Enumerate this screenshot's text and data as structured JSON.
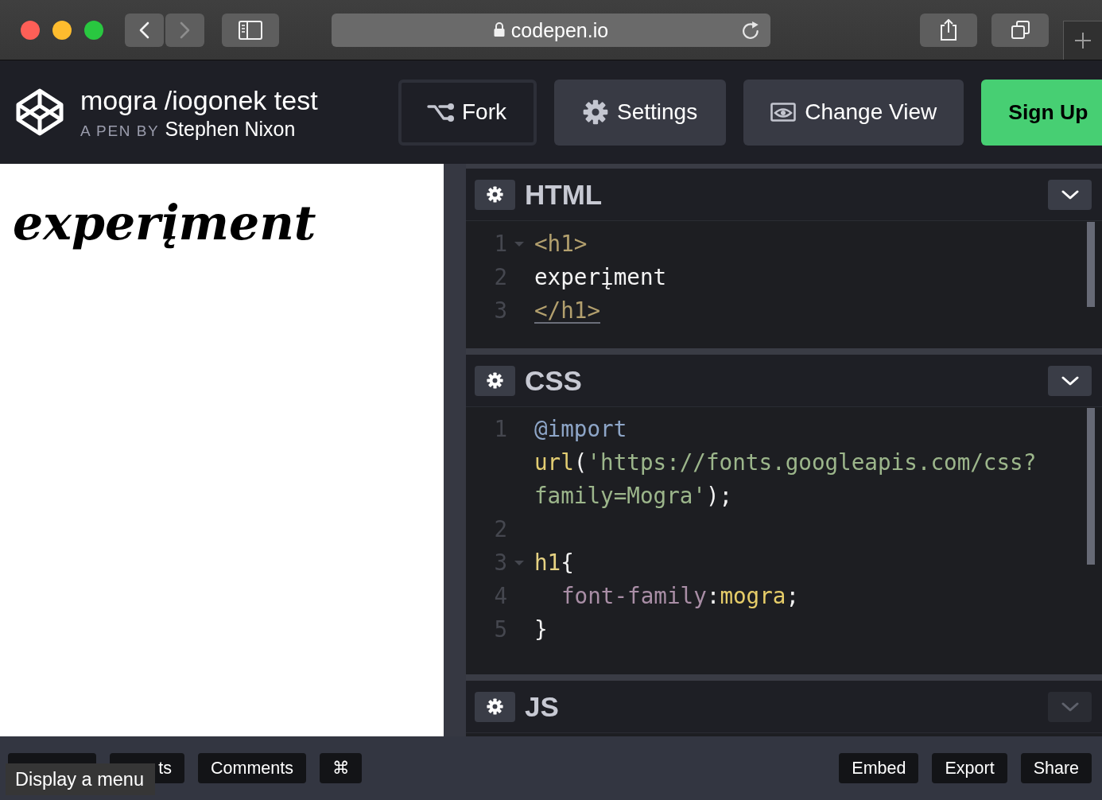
{
  "browser": {
    "back": {
      "disabled": false
    },
    "forward": {
      "disabled": true
    },
    "url": "codepen.io"
  },
  "header": {
    "title": "mogra /iogonek test",
    "byline_prefix": "A PEN BY",
    "author": "Stephen Nixon",
    "buttons": [
      {
        "label": "Fork",
        "kind": "outline"
      },
      {
        "label": "Settings",
        "kind": "default"
      },
      {
        "label": "Change View",
        "kind": "default"
      },
      {
        "label": "Sign Up",
        "kind": "primary"
      }
    ]
  },
  "preview": {
    "heading": "experįment"
  },
  "editors": [
    {
      "title": "HTML",
      "collapse_disabled": false,
      "lines": [
        {
          "number": "1",
          "foldable": true,
          "matched": false,
          "rows": [
            {
              "tokens": [
                {
                  "text": "<h1>",
                  "kind": "tag"
                }
              ]
            }
          ]
        },
        {
          "number": "2",
          "foldable": false,
          "matched": false,
          "rows": [
            {
              "tokens": [
                {
                  "text": "experįment",
                  "kind": "text"
                }
              ]
            }
          ]
        },
        {
          "number": "3",
          "foldable": false,
          "matched": true,
          "rows": [
            {
              "tokens": [
                {
                  "text": "</h1>",
                  "kind": "tag"
                }
              ]
            }
          ]
        }
      ]
    },
    {
      "title": "CSS",
      "collapse_disabled": false,
      "lines": [
        {
          "number": "1",
          "foldable": false,
          "matched": false,
          "rows": [
            {
              "tokens": [
                {
                  "text": "@import",
                  "kind": "keyword"
                }
              ]
            },
            {
              "tokens": [
                {
                  "text": "url",
                  "kind": "function"
                },
                {
                  "text": "(",
                  "kind": "punct"
                },
                {
                  "text": "'https://fonts.googleapis.com/css?",
                  "kind": "string"
                }
              ]
            },
            {
              "tokens": [
                {
                  "text": "family=Mogra'",
                  "kind": "string"
                },
                {
                  "text": ");",
                  "kind": "punct"
                }
              ]
            }
          ]
        },
        {
          "number": "2",
          "foldable": false
        },
        {
          "number": "3",
          "foldable": true,
          "matched": false,
          "rows": [
            {
              "tokens": [
                {
                  "text": "h1",
                  "kind": "selector"
                },
                {
                  "text": "{",
                  "kind": "punct"
                }
              ]
            }
          ],
          "children": [
            {
              "number": "4",
              "foldable": false,
              "matched": false,
              "rows": [
                {
                  "tokens": [
                    {
                      "text": "font-family",
                      "kind": "property"
                    },
                    {
                      "text": ":",
                      "kind": "punct"
                    },
                    {
                      "text": "mogra",
                      "kind": "value"
                    },
                    {
                      "text": ";",
                      "kind": "punct"
                    }
                  ]
                }
              ]
            }
          ]
        },
        {
          "number": "5",
          "foldable": false,
          "matched": false,
          "rows": [
            {
              "tokens": [
                {
                  "text": "}",
                  "kind": "punct"
                }
              ]
            }
          ]
        }
      ]
    },
    {
      "title": "JS",
      "collapse_disabled": true
    }
  ],
  "footer": {
    "left_buttons": [
      {
        "covered": true
      },
      {
        "label": "ts",
        "covered": true
      },
      {
        "label": "Comments",
        "covered": false
      },
      {
        "label": "⌘",
        "covered": false
      }
    ],
    "tooltip": "Display a menu",
    "right_buttons": [
      {
        "label": "Embed"
      },
      {
        "label": "Export"
      },
      {
        "label": "Share"
      }
    ]
  }
}
